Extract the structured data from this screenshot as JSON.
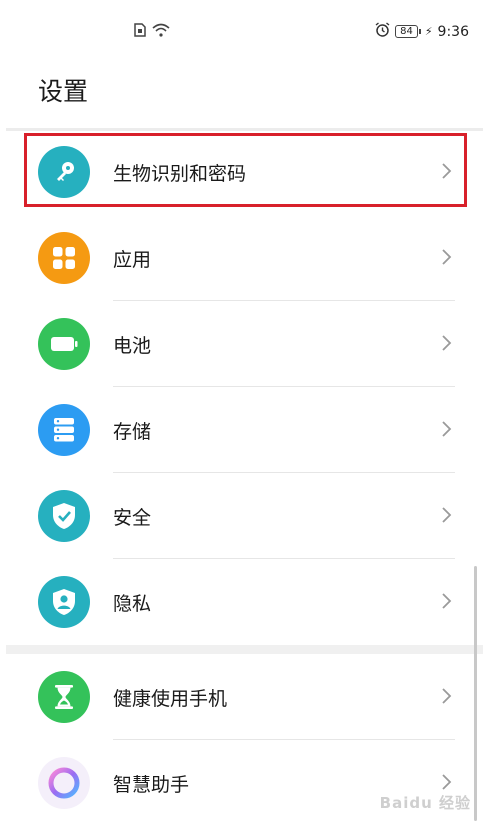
{
  "status_bar": {
    "time": "9:36",
    "battery_level": "84"
  },
  "header": {
    "title": "设置"
  },
  "settings_items": [
    {
      "label": "生物识别和密码",
      "icon": "key-icon",
      "color": "#26b0bf",
      "highlighted": true
    },
    {
      "label": "应用",
      "icon": "apps-grid-icon",
      "color": "#f59a12"
    },
    {
      "label": "电池",
      "icon": "battery-icon",
      "color": "#34c25a"
    },
    {
      "label": "存储",
      "icon": "storage-icon",
      "color": "#2c9cf2"
    },
    {
      "label": "安全",
      "icon": "shield-check-icon",
      "color": "#26b0bf"
    },
    {
      "label": "隐私",
      "icon": "privacy-icon",
      "color": "#26b0bf"
    },
    {
      "label": "健康使用手机",
      "icon": "hourglass-icon",
      "color": "#34c25a"
    },
    {
      "label": "智慧助手",
      "icon": "assistant-ring-icon",
      "color": "#b06cf0"
    }
  ],
  "watermark": "Baidu 经验",
  "colors": {
    "highlight": "#d8202a",
    "divider": "#e6e6e6"
  }
}
